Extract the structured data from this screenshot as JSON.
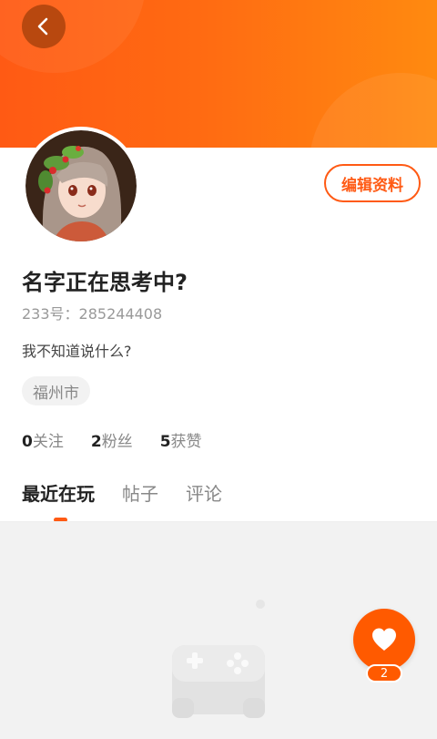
{
  "header": {
    "back_icon": "chevron-left-icon",
    "bg_color": "#ff6a12"
  },
  "profile": {
    "avatar_icon": "anime-avatar",
    "edit_label": "编辑资料",
    "nickname": "名字正在思考中?",
    "uid": "233号：285244408",
    "bio": "我不知道说什么?",
    "location": "福州市"
  },
  "stats": [
    {
      "value": "0",
      "label": "关注"
    },
    {
      "value": "2",
      "label": "粉丝"
    },
    {
      "value": "5",
      "label": "获赞"
    }
  ],
  "tabs": [
    {
      "label": "最近在玩"
    },
    {
      "label": "帖子"
    },
    {
      "label": "评论"
    }
  ],
  "empty_state": {
    "icon": "gamepad-icon"
  },
  "like": {
    "icon": "heart-icon",
    "count": "2",
    "accent": "#ff5a00"
  }
}
